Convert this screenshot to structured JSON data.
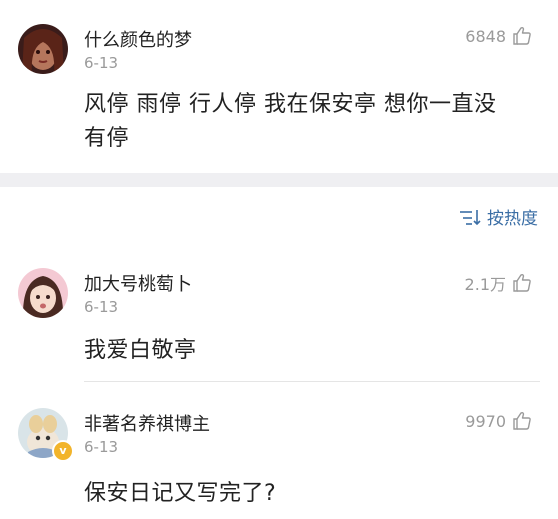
{
  "comments": [
    {
      "username": "什么颜色的梦",
      "date": "6-13",
      "likes": "6848",
      "text_line1": "风停 雨停 行人停 我在保安亭 想你一直没",
      "text_line2": "有停"
    },
    {
      "username": "加大号桃萄卜",
      "date": "6-13",
      "likes": "2.1万",
      "text": "我爱白敬亭"
    },
    {
      "username": "非著名养祺博主",
      "date": "6-13",
      "likes": "9970",
      "text": "保安日记又写完了?",
      "verified_badge": "v"
    }
  ],
  "sort": {
    "label": "按热度"
  },
  "colors": {
    "link_blue": "#3b6ea5",
    "badge_gold": "#f2b42b",
    "muted": "#9a9a9a"
  },
  "icons": {
    "like": "thumbs-up-icon",
    "sort": "sort-icon"
  }
}
